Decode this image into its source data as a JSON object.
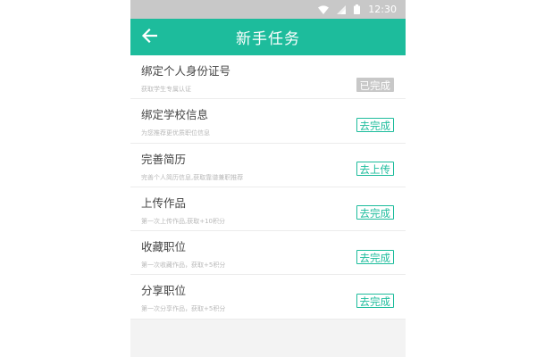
{
  "status_bar": {
    "time": "12:30",
    "icons": [
      "wifi-icon",
      "signal-icon",
      "battery-icon"
    ]
  },
  "app_bar": {
    "back_icon": "arrow-left-icon",
    "title": "新手任务"
  },
  "colors": {
    "accent": "#1dbc9c",
    "done_bg": "#c8c8c8",
    "status_bar_bg": "#c8c8c8"
  },
  "tasks": [
    {
      "name": "绑定个人身份证号",
      "desc": "获取学生专属认证",
      "action": "已完成",
      "state": "done"
    },
    {
      "name": "绑定学校信息",
      "desc": "为您推荐更优质职位信息",
      "action": "去完成",
      "state": "todo"
    },
    {
      "name": "完善简历",
      "desc": "完善个人简历信息,获取靠谱兼职推荐",
      "action": "去上传",
      "state": "todo"
    },
    {
      "name": "上传作品",
      "desc": "第一次上传作品,获取+10积分",
      "action": "去完成",
      "state": "todo"
    },
    {
      "name": "收藏职位",
      "desc": "第一次收藏作品，获取+5积分",
      "action": "去完成",
      "state": "todo"
    },
    {
      "name": "分享职位",
      "desc": "第一次分享作品，获取+5积分",
      "action": "去完成",
      "state": "todo"
    }
  ]
}
